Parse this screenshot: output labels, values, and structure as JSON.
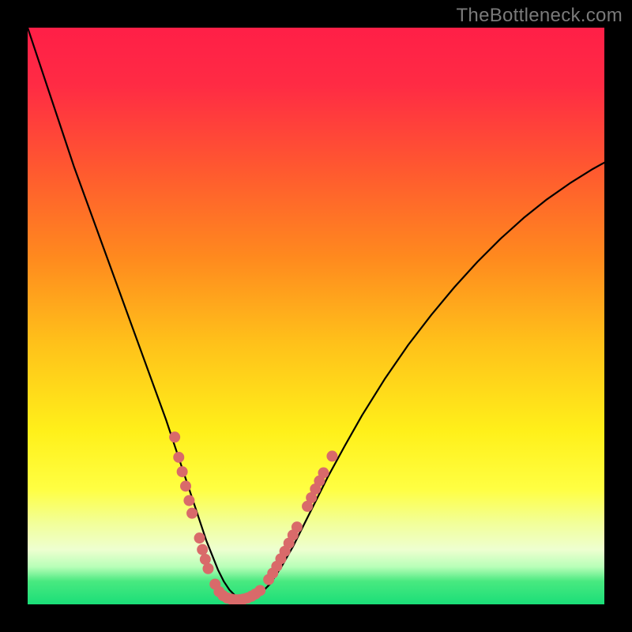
{
  "watermark": "TheBottleneck.com",
  "chart_data": {
    "type": "line",
    "title": "",
    "xlabel": "",
    "ylabel": "",
    "xlim": [
      0,
      100
    ],
    "ylim": [
      0,
      100
    ],
    "gradient_stops": [
      {
        "offset": 0.0,
        "color": "#ff1f47"
      },
      {
        "offset": 0.1,
        "color": "#ff2b44"
      },
      {
        "offset": 0.25,
        "color": "#ff5a2f"
      },
      {
        "offset": 0.4,
        "color": "#ff8a1e"
      },
      {
        "offset": 0.55,
        "color": "#ffc21a"
      },
      {
        "offset": 0.7,
        "color": "#fff01a"
      },
      {
        "offset": 0.8,
        "color": "#ffff42"
      },
      {
        "offset": 0.86,
        "color": "#f2ff9a"
      },
      {
        "offset": 0.905,
        "color": "#eeffd0"
      },
      {
        "offset": 0.935,
        "color": "#b8ffb8"
      },
      {
        "offset": 0.96,
        "color": "#49e980"
      },
      {
        "offset": 1.0,
        "color": "#1ade78"
      }
    ],
    "curve": {
      "x": [
        0,
        2,
        4,
        6,
        8,
        10,
        12,
        14,
        16,
        18,
        20,
        22,
        24,
        26,
        27,
        28,
        29,
        30,
        31,
        32,
        33,
        34,
        35,
        36,
        37,
        38,
        40,
        42,
        44,
        46,
        48,
        50,
        52,
        55,
        58,
        62,
        66,
        70,
        74,
        78,
        82,
        86,
        90,
        94,
        98,
        100
      ],
      "y": [
        100,
        94,
        88,
        82,
        76,
        70.5,
        65,
        59.5,
        54,
        48.5,
        43,
        37.5,
        32,
        26,
        23,
        20,
        17,
        14,
        11,
        8.5,
        6.0,
        4.0,
        2.5,
        1.5,
        1.0,
        1.0,
        1.5,
        3.5,
        6.5,
        10.0,
        14.0,
        18.0,
        22.0,
        27.5,
        32.8,
        39.2,
        45.0,
        50.2,
        55.0,
        59.4,
        63.4,
        67.0,
        70.2,
        73.0,
        75.5,
        76.6
      ]
    },
    "series": [
      {
        "name": "markers",
        "color": "#d96a6a",
        "points": [
          {
            "x": 25.5,
            "y": 29.0
          },
          {
            "x": 26.2,
            "y": 25.5
          },
          {
            "x": 26.8,
            "y": 23.0
          },
          {
            "x": 27.4,
            "y": 20.5
          },
          {
            "x": 28.0,
            "y": 18.0
          },
          {
            "x": 28.5,
            "y": 15.8
          },
          {
            "x": 29.8,
            "y": 11.5
          },
          {
            "x": 30.3,
            "y": 9.5
          },
          {
            "x": 30.8,
            "y": 7.8
          },
          {
            "x": 31.3,
            "y": 6.2
          },
          {
            "x": 32.5,
            "y": 3.5
          },
          {
            "x": 33.2,
            "y": 2.2
          },
          {
            "x": 33.9,
            "y": 1.5
          },
          {
            "x": 34.6,
            "y": 1.1
          },
          {
            "x": 35.3,
            "y": 0.9
          },
          {
            "x": 36.0,
            "y": 0.8
          },
          {
            "x": 36.7,
            "y": 0.8
          },
          {
            "x": 37.4,
            "y": 0.9
          },
          {
            "x": 38.1,
            "y": 1.1
          },
          {
            "x": 38.8,
            "y": 1.4
          },
          {
            "x": 39.5,
            "y": 1.8
          },
          {
            "x": 40.3,
            "y": 2.4
          },
          {
            "x": 41.8,
            "y": 4.3
          },
          {
            "x": 42.5,
            "y": 5.4
          },
          {
            "x": 43.2,
            "y": 6.6
          },
          {
            "x": 43.9,
            "y": 7.9
          },
          {
            "x": 44.6,
            "y": 9.2
          },
          {
            "x": 45.3,
            "y": 10.6
          },
          {
            "x": 46.0,
            "y": 12.0
          },
          {
            "x": 46.7,
            "y": 13.4
          },
          {
            "x": 48.5,
            "y": 17.0
          },
          {
            "x": 49.2,
            "y": 18.5
          },
          {
            "x": 49.9,
            "y": 20.0
          },
          {
            "x": 50.6,
            "y": 21.4
          },
          {
            "x": 51.3,
            "y": 22.8
          },
          {
            "x": 52.8,
            "y": 25.7
          }
        ]
      }
    ]
  }
}
